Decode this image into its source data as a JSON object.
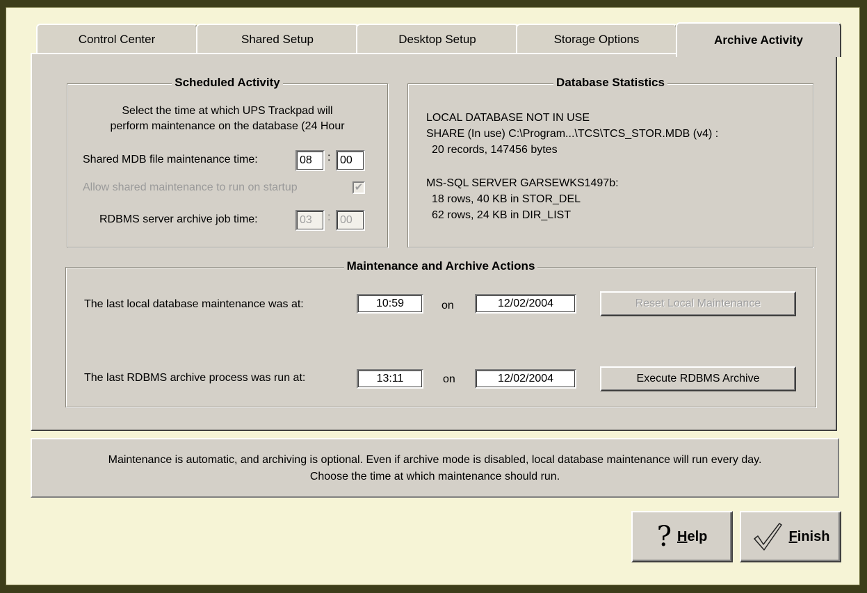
{
  "tabs": [
    {
      "label": "Control Center"
    },
    {
      "label": "Shared Setup"
    },
    {
      "label": "Desktop Setup"
    },
    {
      "label": "Storage Options"
    },
    {
      "label": "Archive Activity",
      "active": true
    }
  ],
  "scheduled": {
    "title": "Scheduled Activity",
    "desc_line1": "Select the time at which UPS Trackpad will",
    "desc_line2": "perform maintenance on the database (24 Hour",
    "mdb_label": "Shared MDB file maintenance time:",
    "mdb_hour": "08",
    "mdb_minute": "00",
    "colon": ":",
    "startup_label": "Allow shared maintenance to run on startup",
    "startup_checked": true,
    "rdbms_label": "RDBMS server archive job time:",
    "rdbms_hour": "03",
    "rdbms_minute": "00"
  },
  "stats": {
    "title": "Database Statistics",
    "line1": "LOCAL DATABASE NOT IN USE",
    "line2": "SHARE (In use) C:\\Program...\\TCS\\TCS_STOR.MDB (v4) :",
    "line3": "20 records, 147456 bytes",
    "line4": "MS-SQL SERVER GARSEWKS1497b:",
    "line5": "18 rows, 40 KB in STOR_DEL",
    "line6": "62 rows, 24 KB in DIR_LIST"
  },
  "actions": {
    "title": "Maintenance and Archive Actions",
    "local_label": "The last local database maintenance was at:",
    "local_time": "10:59",
    "on_label": "on",
    "local_date": "12/02/2004",
    "reset_button": "Reset Local Maintenance",
    "rdbms_label": "The last RDBMS archive process was run at:",
    "rdbms_time": "13:11",
    "rdbms_date": "12/02/2004",
    "execute_button": "Execute RDBMS Archive"
  },
  "status": {
    "line1": "Maintenance is automatic, and archiving is optional.  Even if archive mode is disabled, local database maintenance will run every day.",
    "line2": "Choose the time at which maintenance should run."
  },
  "buttons": {
    "help_hotkey": "H",
    "help_rest": "elp",
    "finish_hotkey": "F",
    "finish_rest": "inish"
  }
}
